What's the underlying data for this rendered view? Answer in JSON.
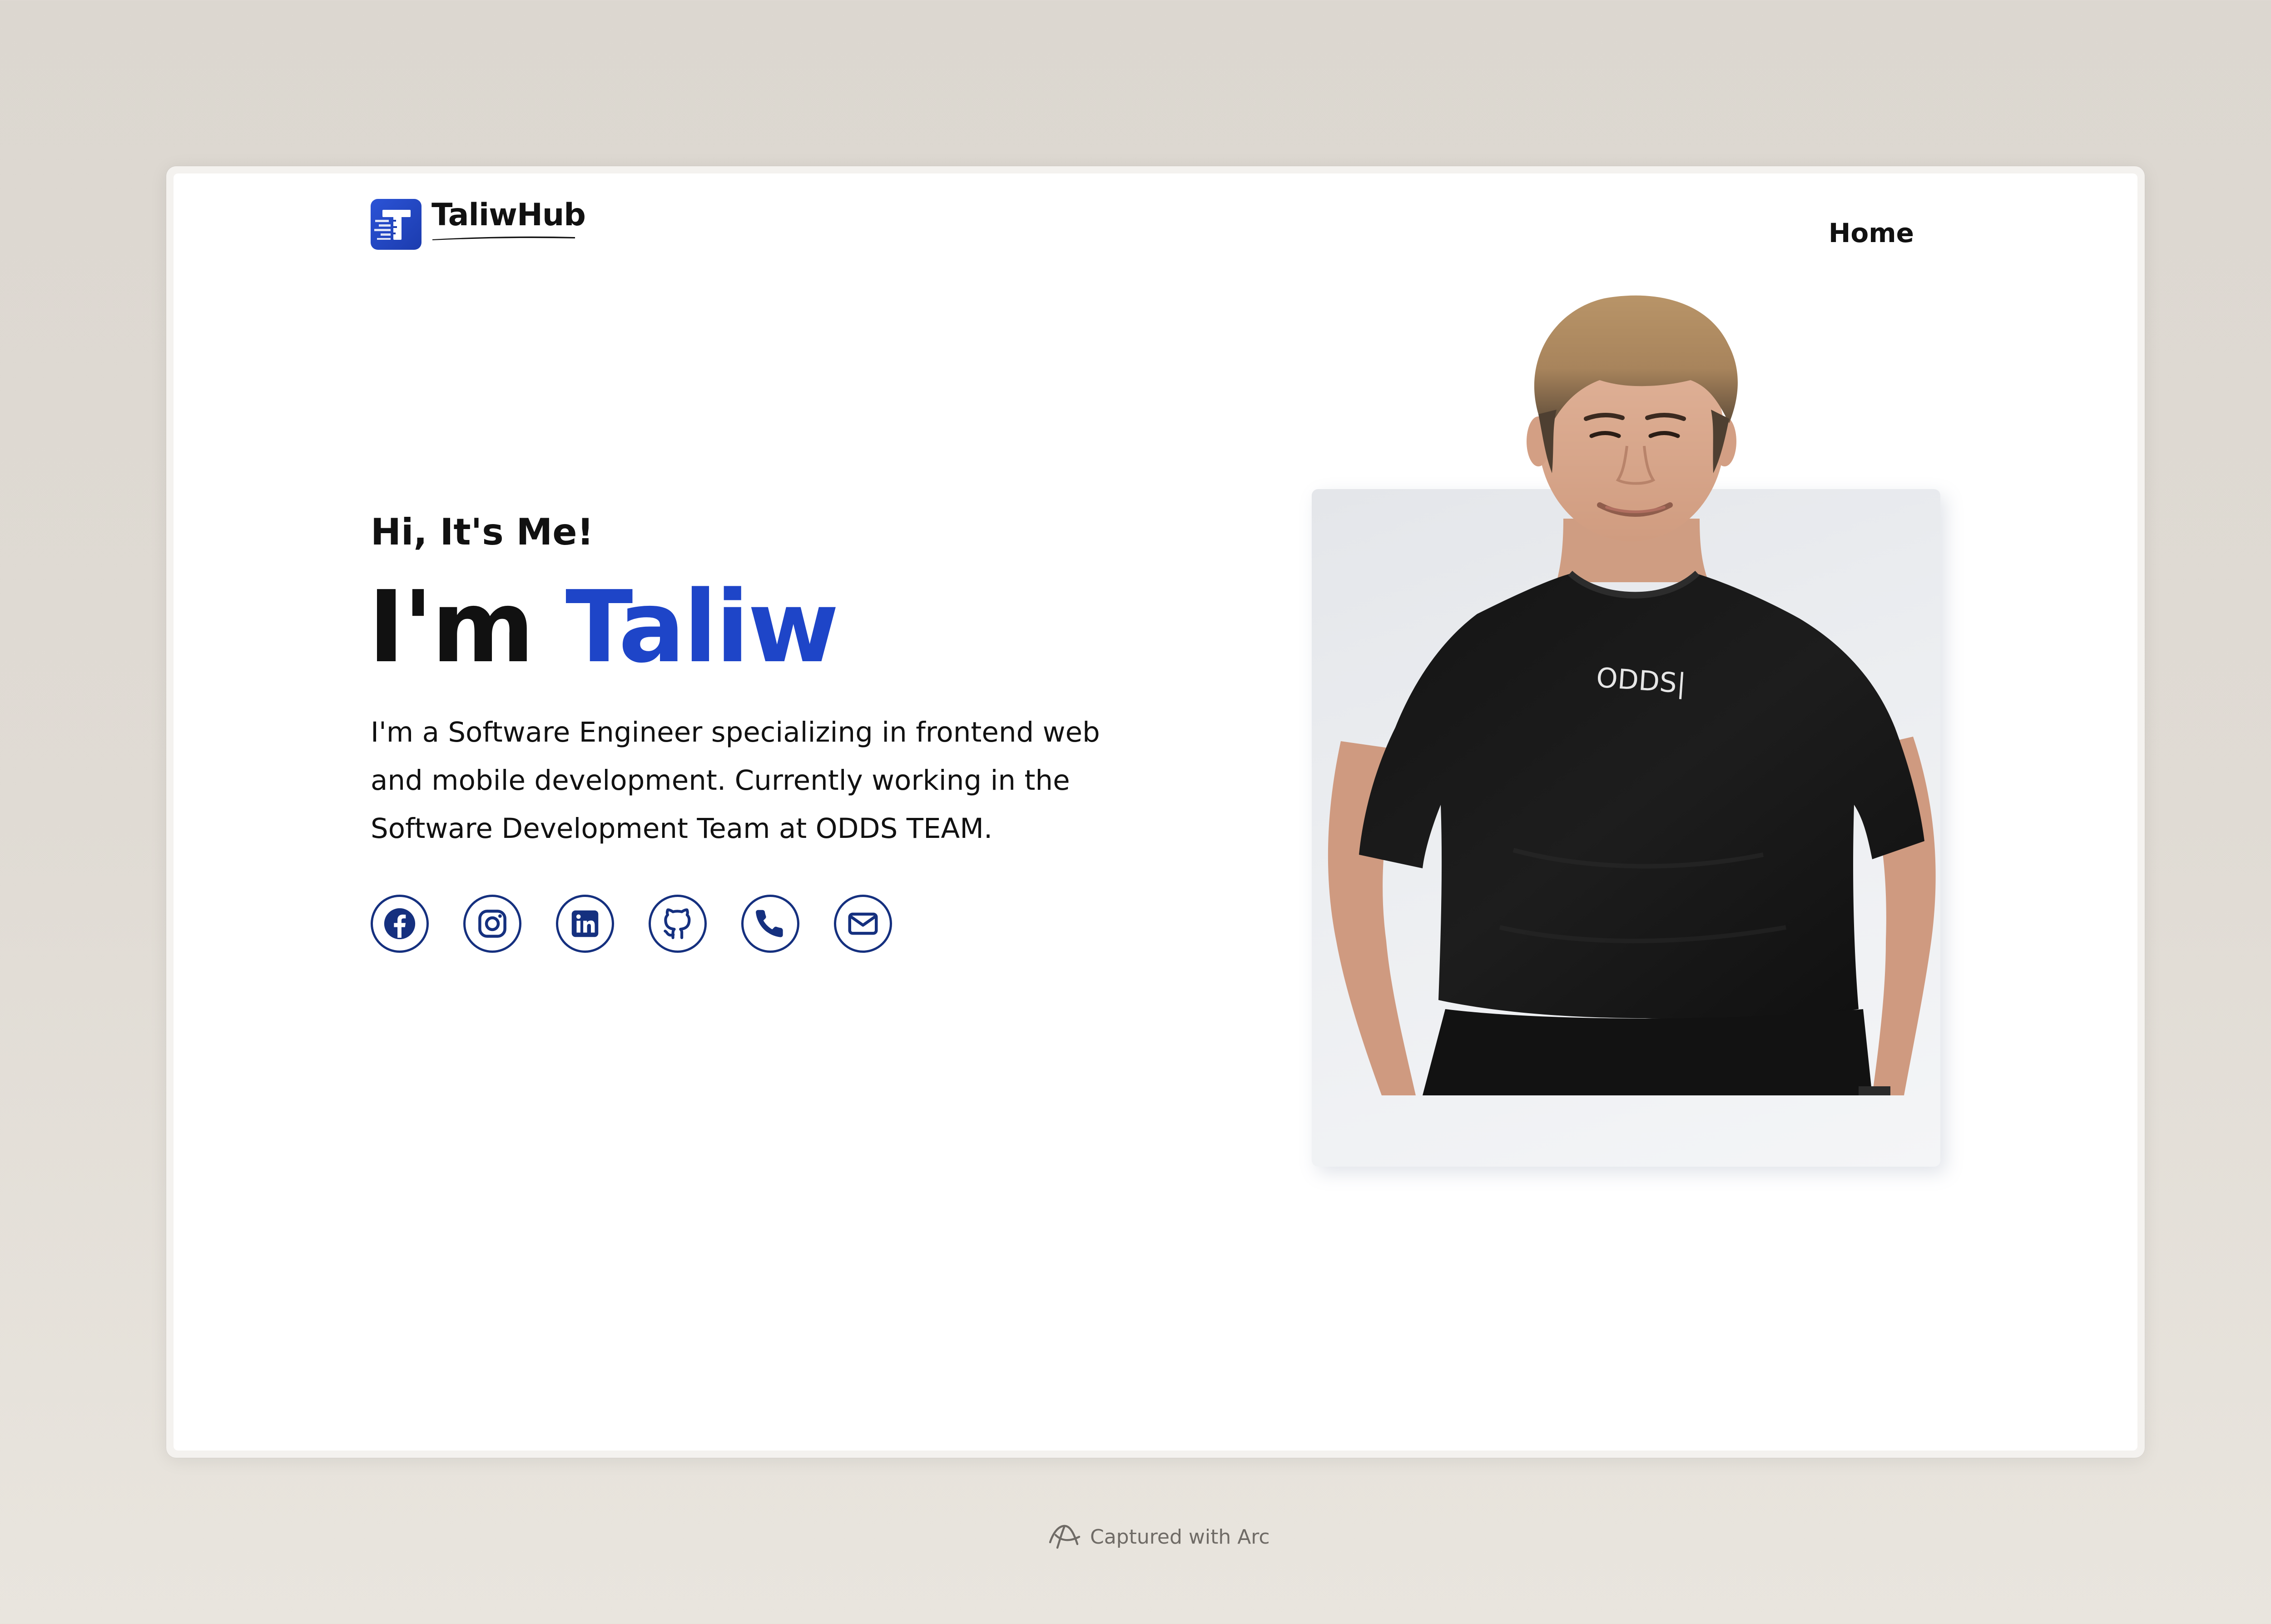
{
  "header": {
    "logo_text": "TaliwHub",
    "logo_letter": "T",
    "nav": [
      "Home"
    ]
  },
  "hero": {
    "greeting": "Hi, It's Me!",
    "headline_prefix": "I'm ",
    "headline_name": "Taliw",
    "description": "I'm a Software Engineer specializing in frontend web and mobile development. Currently working in the Software Development Team at ODDS TEAM.",
    "socials": [
      {
        "icon": "facebook-icon"
      },
      {
        "icon": "instagram-icon"
      },
      {
        "icon": "linkedin-icon"
      },
      {
        "icon": "github-icon"
      },
      {
        "icon": "phone-icon"
      },
      {
        "icon": "mail-icon"
      }
    ],
    "shirt_text": "ODDS|"
  },
  "footer": {
    "caption": "Captured with Arc"
  },
  "colors": {
    "accent": "#1e45c8",
    "icon_stroke": "#15307f",
    "logo_bg": "#2b53d6",
    "background": "#dfdad3"
  }
}
